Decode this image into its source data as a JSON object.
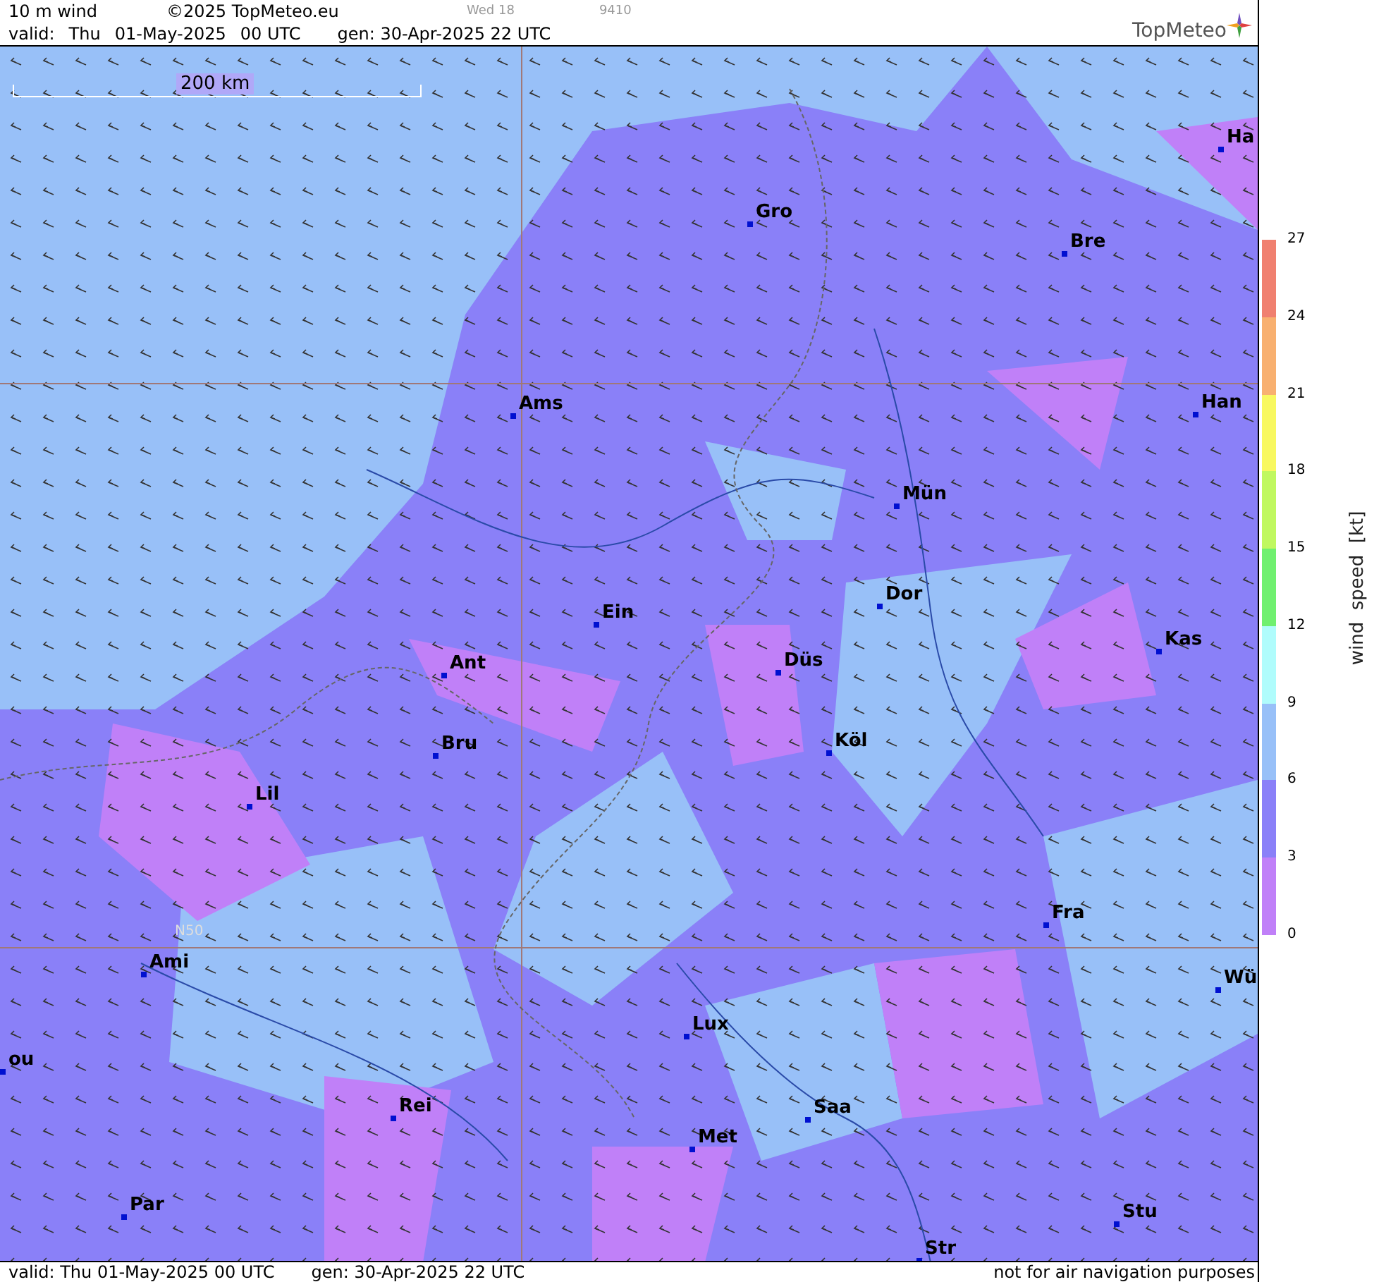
{
  "header": {
    "parameter": "10 m wind",
    "copyright": "©2025 TopMeteo.eu",
    "slot": "Wed 18",
    "code": "9410",
    "valid_label": "valid:",
    "valid_day": "Thu",
    "valid_date": "01-May-2025",
    "valid_time": "00 UTC",
    "gen": "gen: 30-Apr-2025 22 UTC"
  },
  "logo": {
    "text": "TopMeteo"
  },
  "map": {
    "scale": "200 km",
    "latitude_label": "N50",
    "cities": [
      "Ha",
      "Gro",
      "Bre",
      "Ams",
      "Han",
      "Mün",
      "Dor",
      "Ein",
      "Kas",
      "Ant",
      "Düs",
      "Köl",
      "Bru",
      "Lil",
      "Fra",
      "Ami",
      "Wü",
      "Lux",
      "ou",
      "Rei",
      "Saa",
      "Met",
      "Par",
      "Stu",
      "Str"
    ]
  },
  "legend": {
    "title": "wind  speed  [kt]",
    "ticks": [
      "27",
      "24",
      "21",
      "18",
      "15",
      "12",
      "9",
      "6",
      "3",
      "0"
    ],
    "bands": [
      {
        "color": "#f08070"
      },
      {
        "color": "#f8b070"
      },
      {
        "color": "#f8f860"
      },
      {
        "color": "#c0f860"
      },
      {
        "color": "#70f070"
      },
      {
        "color": "#b0fcfc"
      },
      {
        "color": "#98c0f8"
      },
      {
        "color": "#8a80f8"
      },
      {
        "color": "#c080f8"
      }
    ]
  },
  "footer": {
    "valid": "valid:  Thu  01-May-2025  00 UTC",
    "gen": "gen: 30-Apr-2025 22 UTC",
    "note": "not for air navigation purposes"
  }
}
